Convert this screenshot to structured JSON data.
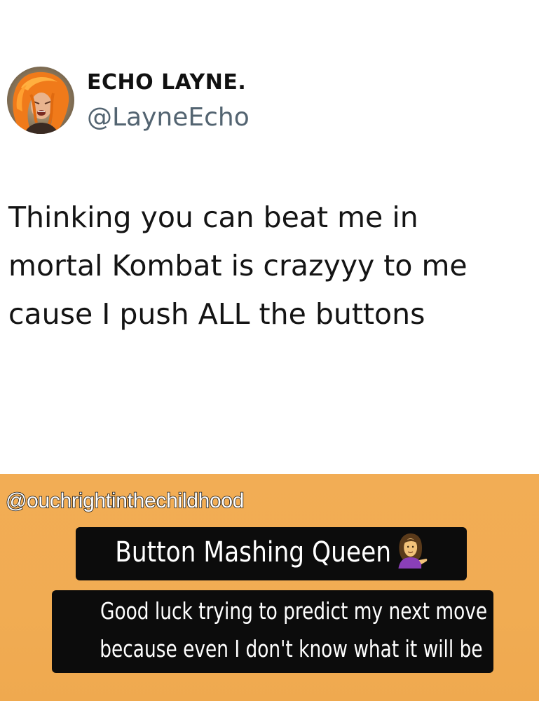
{
  "tweet": {
    "author": {
      "display_name": "ECHO LAYNE.",
      "handle": "@LayneEcho",
      "avatar_icon": "profile-photo-avatar"
    },
    "text_lines": [
      "Thinking you can beat me in",
      "mortal Kombat is crazyyy to me",
      "cause I push ALL the buttons"
    ]
  },
  "caption": {
    "credit": "@ouchrightinthechildhood",
    "title": "Button Mashing Queen",
    "title_emoji": "woman-tipping-hand-emoji",
    "subtitle_lines": [
      "Good luck trying to predict my next move",
      "because even I don't know what it will be"
    ]
  },
  "colors": {
    "tweet_background": "#ffffff",
    "panel_background": "#f1ac53",
    "caption_box": "#0c0c0c",
    "handle_gray": "#536471"
  }
}
